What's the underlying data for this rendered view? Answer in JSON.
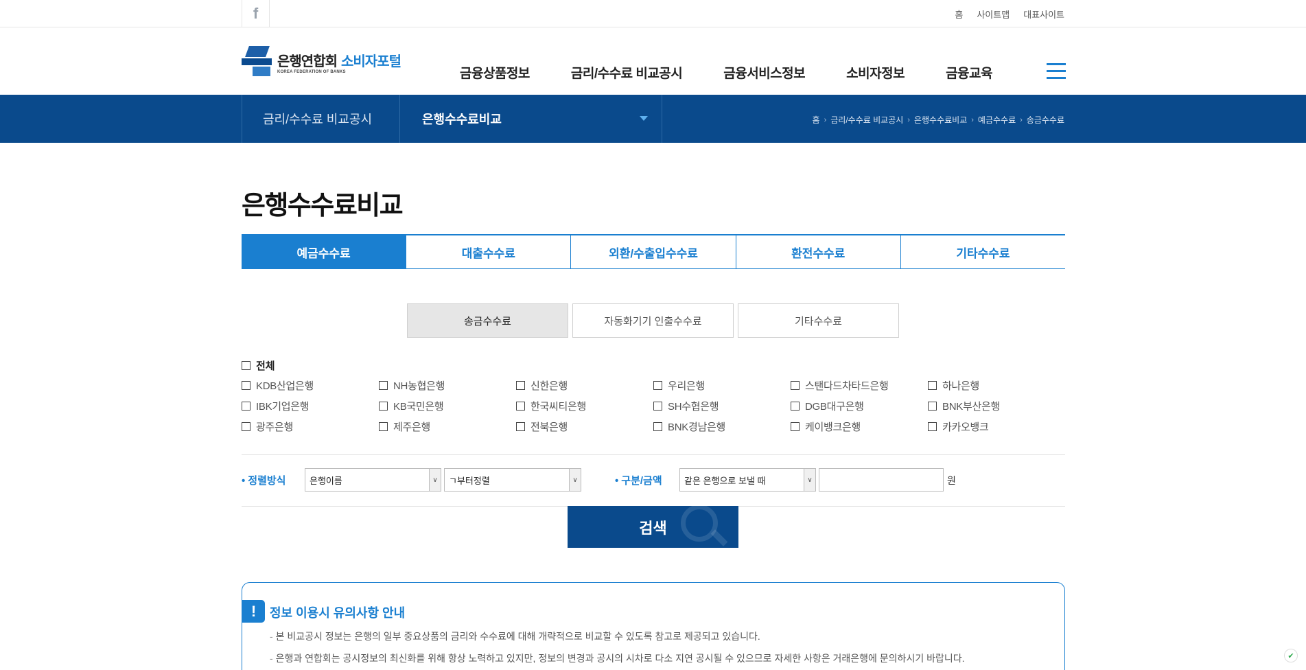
{
  "util": {
    "facebook_icon": "f",
    "links": [
      "홈",
      "사이트맵",
      "대표사이트"
    ]
  },
  "logo": {
    "name": "은행연합회",
    "portal": "소비자포털",
    "english": "KOREA FEDERATION OF BANKS"
  },
  "gnb": [
    "금융상품정보",
    "금리/수수료 비교공시",
    "금융서비스정보",
    "소비자정보",
    "금융교육"
  ],
  "subnav": {
    "depth1": "금리/수수료 비교공시",
    "depth2": "은행수수료비교",
    "breadcrumb": [
      "홈",
      "금리/수수료 비교공시",
      "은행수수료비교",
      "예금수수료",
      "송금수수료"
    ]
  },
  "page_title": "은행수수료비교",
  "tabs": [
    "예금수수료",
    "대출수수료",
    "외환/수출입수수료",
    "환전수수료",
    "기타수수료"
  ],
  "active_tab": 0,
  "subtabs": [
    "송금수수료",
    "자동화기기 인출수수료",
    "기타수수료"
  ],
  "active_subtab": 0,
  "all_label": "전체",
  "banks": [
    "KDB산업은행",
    "NH농협은행",
    "신한은행",
    "우리은행",
    "스탠다드차타드은행",
    "하나은행",
    "IBK기업은행",
    "KB국민은행",
    "한국씨티은행",
    "SH수협은행",
    "DGB대구은행",
    "BNK부산은행",
    "광주은행",
    "제주은행",
    "전북은행",
    "BNK경남은행",
    "케이뱅크은행",
    "카카오뱅크"
  ],
  "filter": {
    "sort_label": "정렬방식",
    "sort_by": "은행이름",
    "sort_order": "ㄱ부터정렬",
    "type_label": "구분/금액",
    "type_value": "같은 은행으로 보낼 때",
    "amount_value": "",
    "unit": "원"
  },
  "search_label": "검색",
  "notice": {
    "icon": "!",
    "title": "정보 이용시 유의사항 안내",
    "lines": [
      "본 비교공시 정보는 은행의 일부 중요상품의 금리와 수수료에 대해 개략적으로 비교할 수 있도록 참고로 제공되고 있습니다.",
      "은행과 연합회는 공시정보의 최신화를 위해 항상 노력하고 있지만, 정보의 변경과 공시의 시차로 다소 지연 공시될 수 있으므로 자세한 사항은 거래은행에 문의하시기 바랍니다."
    ]
  },
  "colors": {
    "primary": "#1a7fd0",
    "navy": "#0a4a8c"
  }
}
